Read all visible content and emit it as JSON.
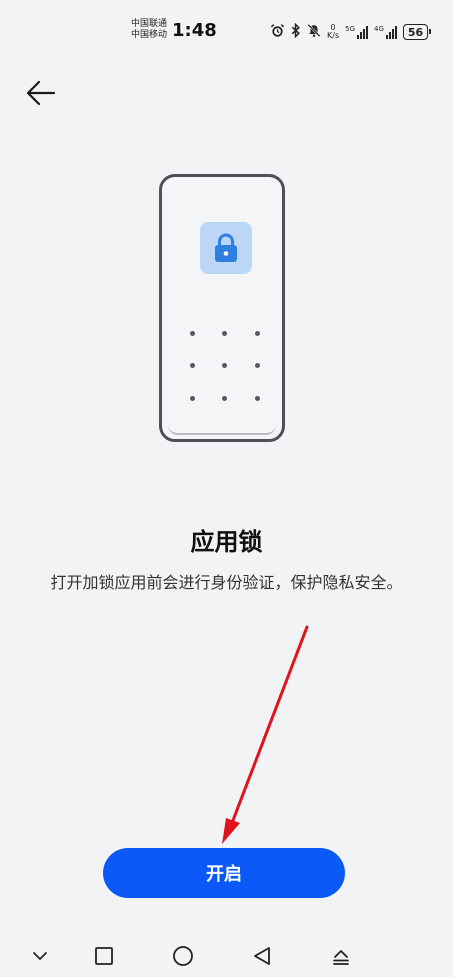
{
  "status_bar": {
    "carrier_1": "中国联通",
    "carrier_2": "中国移动",
    "time": "1:48",
    "net_speed_value": "0",
    "net_speed_unit": "K/s",
    "signal_1_label": "5G",
    "signal_2_label": "4G",
    "battery": "56"
  },
  "page": {
    "title": "应用锁",
    "description": "打开加锁应用前会进行身份验证，保护隐私安全。",
    "open_button_label": "开启"
  },
  "icons": {
    "back": "arrow-left-icon",
    "lock": "padlock-icon",
    "nav_collapse": "chevron-down-icon",
    "nav_recents": "square-icon",
    "nav_home": "circle-icon",
    "nav_back": "triangle-left-icon",
    "nav_extra": "eject-icon"
  },
  "colors": {
    "accent": "#0a59f7",
    "annotation_arrow": "#e0141c",
    "lock_tile": "#bcd7f5",
    "lock_blue": "#2f7fe0"
  }
}
